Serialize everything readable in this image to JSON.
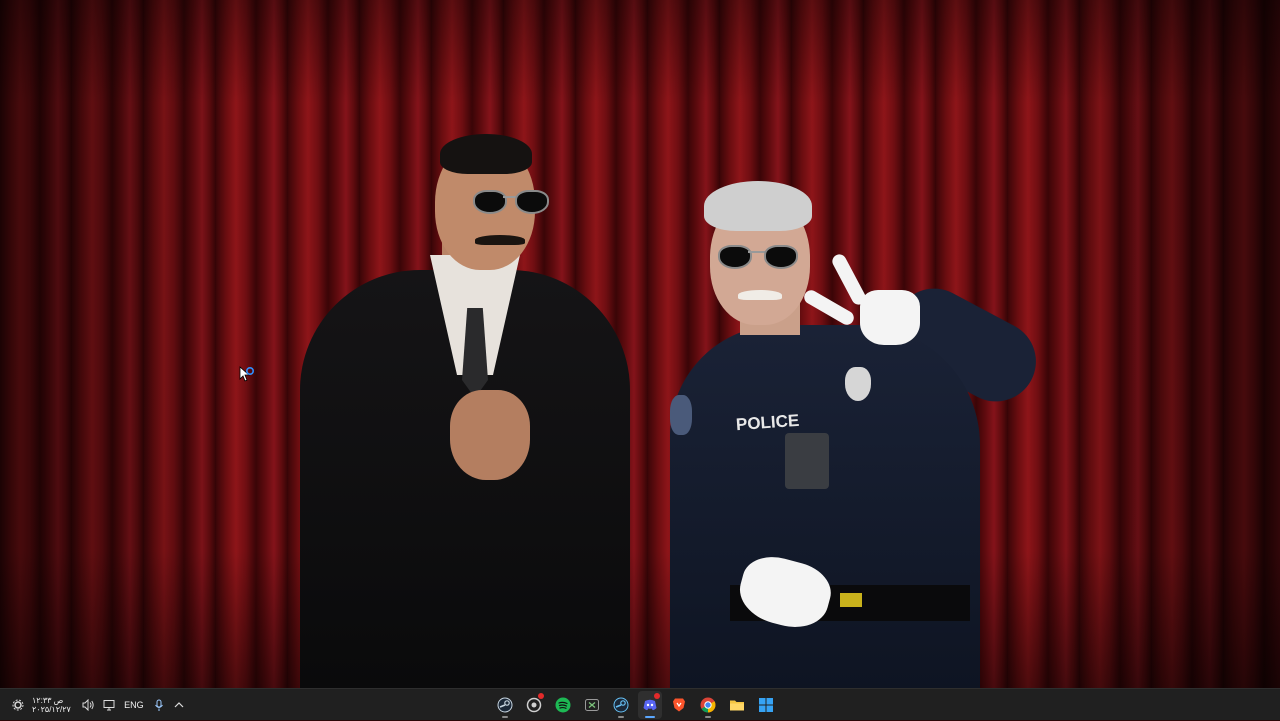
{
  "wallpaper": {
    "shirt_text": "POLICE"
  },
  "taskbar": {
    "tray": {
      "time": "۱۲:۳۳ ص",
      "date": "۲۰۲۵/۱۲/۲۷",
      "language": "ENG",
      "icons": [
        "settings-icon",
        "volume-icon",
        "network-icon",
        "microphone-icon",
        "chevron-up-icon"
      ]
    },
    "apps": [
      {
        "name": "steam",
        "icon": "steam-icon",
        "active": false
      },
      {
        "name": "steelseries",
        "icon": "steelseries-icon",
        "active": false,
        "badge": true
      },
      {
        "name": "spotify",
        "icon": "spotify-icon",
        "active": false
      },
      {
        "name": "xbox",
        "icon": "xbox-icon",
        "active": false
      },
      {
        "name": "steam-2",
        "icon": "steam-icon",
        "active": false
      },
      {
        "name": "discord",
        "icon": "discord-icon",
        "active": true,
        "badge": true
      },
      {
        "name": "brave",
        "icon": "brave-icon",
        "active": false
      },
      {
        "name": "chrome",
        "icon": "chrome-icon",
        "active": false
      },
      {
        "name": "file-explorer",
        "icon": "folder-icon",
        "active": false
      },
      {
        "name": "start",
        "icon": "windows-icon",
        "active": false
      }
    ],
    "colors": {
      "background": "#202020",
      "spotify": "#1db954",
      "brave": "#fb542b",
      "discord": "#5865f2",
      "folder": "#f4c542",
      "windows": "#36a3f4"
    }
  }
}
